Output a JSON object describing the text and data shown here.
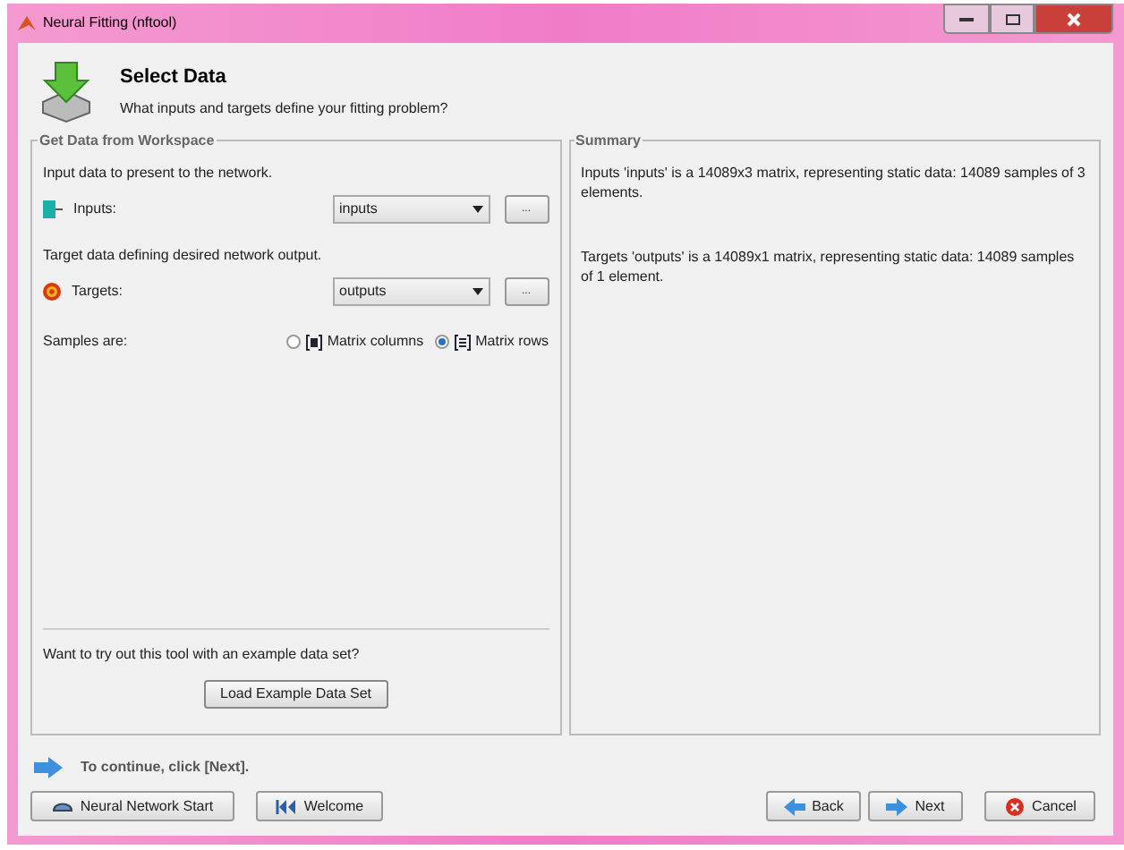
{
  "window": {
    "title": "Neural Fitting (nftool)"
  },
  "header": {
    "title": "Select Data",
    "subtitle": "What inputs and targets define your fitting problem?"
  },
  "workspace_panel": {
    "legend": "Get Data from Workspace",
    "fields": [
      {
        "kind": "inputs",
        "prompt": "Input data to present to the network.",
        "label": "Inputs:",
        "value": "inputs",
        "browse": "..."
      },
      {
        "kind": "targets",
        "prompt": "Target data defining desired network output.",
        "label": "Targets:",
        "value": "outputs",
        "browse": "..."
      }
    ],
    "samples_label": "Samples are:",
    "sample_options": [
      {
        "kind": "columns",
        "label": "Matrix columns",
        "selected": false
      },
      {
        "kind": "rows",
        "label": "Matrix rows",
        "selected": true
      }
    ],
    "example_prompt": "Want to try out this tool with an example data set?",
    "example_button": "Load Example Data Set"
  },
  "summary_panel": {
    "legend": "Summary",
    "lines": [
      "Inputs 'inputs' is a 14089x3 matrix, representing static data: 14089 samples of 3 elements.",
      "Targets 'outputs' is a 14089x1 matrix, representing static data: 14089 samples of 1 element."
    ]
  },
  "hint": "To continue, click [Next].",
  "left_buttons": [
    {
      "kind": "start",
      "label": "Neural Network Start"
    },
    {
      "kind": "welcome",
      "label": "Welcome"
    }
  ],
  "right_buttons": [
    {
      "kind": "back",
      "label": "Back"
    },
    {
      "kind": "next",
      "label": "Next"
    },
    {
      "kind": "cancel",
      "label": "Cancel"
    }
  ]
}
